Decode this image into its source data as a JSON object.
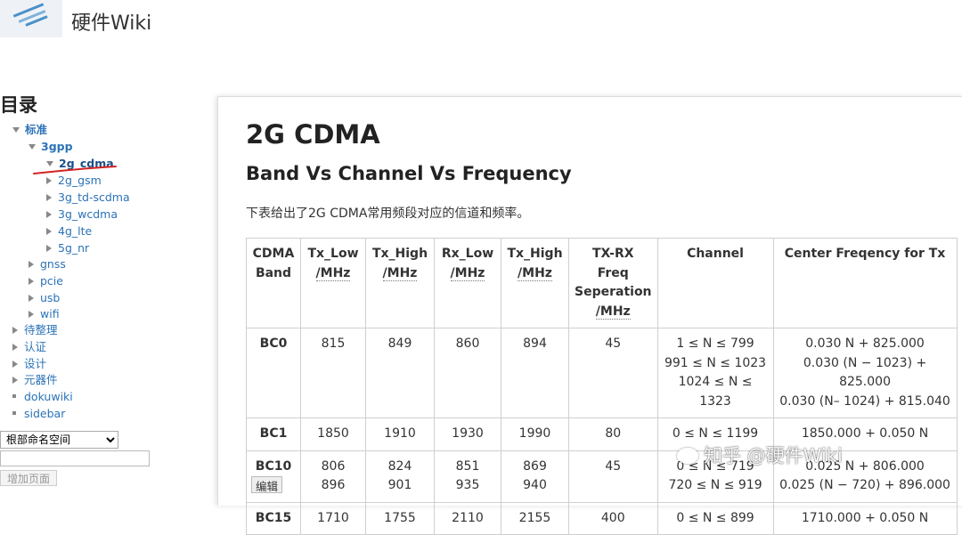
{
  "site": {
    "title": "硬件Wiki"
  },
  "toc": {
    "title": "目录",
    "items": [
      {
        "label": "标准",
        "state": "open"
      },
      {
        "label": "3gpp",
        "state": "open"
      },
      {
        "label": "2g_cdma",
        "state": "open",
        "current": true
      },
      {
        "label": "2g_gsm",
        "state": "closed"
      },
      {
        "label": "3g_td-scdma",
        "state": "closed"
      },
      {
        "label": "3g_wcdma",
        "state": "closed"
      },
      {
        "label": "4g_lte",
        "state": "closed"
      },
      {
        "label": "5g_nr",
        "state": "closed"
      },
      {
        "label": "gnss",
        "state": "closed"
      },
      {
        "label": "pcie",
        "state": "closed"
      },
      {
        "label": "usb",
        "state": "closed"
      },
      {
        "label": "wifi",
        "state": "closed"
      },
      {
        "label": "待整理",
        "state": "closed"
      },
      {
        "label": "认证",
        "state": "closed"
      },
      {
        "label": "设计",
        "state": "closed"
      },
      {
        "label": "元器件",
        "state": "closed"
      },
      {
        "label": "dokuwiki",
        "state": "leaf"
      },
      {
        "label": "sidebar",
        "state": "leaf"
      }
    ],
    "namespace_select": "根部命名空间",
    "add_page_label": "增加页面"
  },
  "page": {
    "h1": "2G CDMA",
    "h2": "Band Vs Channel Vs Frequency",
    "intro": "下表给出了2G CDMA常用频段对应的信道和频率。",
    "table": {
      "headers": [
        [
          "CDMA",
          "Band"
        ],
        [
          "Tx_Low",
          "/MHz"
        ],
        [
          "Tx_High",
          "/MHz"
        ],
        [
          "Rx_Low",
          "/MHz"
        ],
        [
          "Tx_High",
          "/MHz"
        ],
        [
          "TX-RX Freq",
          "Seperation",
          "/MHz"
        ],
        [
          "Channel"
        ],
        [
          "Center Freqency for Tx"
        ]
      ],
      "rows": [
        {
          "band": "BC0",
          "tx_low": [
            "815"
          ],
          "tx_high": [
            "849"
          ],
          "rx_low": [
            "860"
          ],
          "tx_high2": [
            "894"
          ],
          "sep": "45",
          "channel": [
            "1 ≤ N ≤ 799",
            "991 ≤ N ≤ 1023",
            "1024 ≤ N ≤ 1323"
          ],
          "center": [
            "0.030 N + 825.000",
            "0.030 (N − 1023) + 825.000",
            "0.030 (N– 1024) + 815.040"
          ]
        },
        {
          "band": "BC1",
          "tx_low": [
            "1850"
          ],
          "tx_high": [
            "1910"
          ],
          "rx_low": [
            "1930"
          ],
          "tx_high2": [
            "1990"
          ],
          "sep": "80",
          "channel": [
            "0 ≤ N ≤ 1199"
          ],
          "center": [
            "1850.000 + 0.050 N"
          ]
        },
        {
          "band": "BC10",
          "tx_low": [
            "806",
            "896"
          ],
          "tx_high": [
            "824",
            "901"
          ],
          "rx_low": [
            "851",
            "935"
          ],
          "tx_high2": [
            "869",
            "940"
          ],
          "sep": "45",
          "channel": [
            "0 ≤ N ≤ 719",
            "720 ≤ N ≤ 919"
          ],
          "center": [
            "0.025 N + 806.000",
            "0.025 (N − 720) + 896.000"
          ]
        },
        {
          "band": "BC15",
          "tx_low": [
            "1710"
          ],
          "tx_high": [
            "1755"
          ],
          "rx_low": [
            "2110"
          ],
          "tx_high2": [
            "2155"
          ],
          "sep": "400",
          "channel": [
            "0 ≤ N ≤ 899"
          ],
          "center": [
            "1710.000 + 0.050 N"
          ]
        }
      ]
    },
    "edit_label": "编辑"
  },
  "watermark": "知乎 @硬件Wiki",
  "colors": {
    "link": "#2b73b7",
    "annotation_red": "#d42222",
    "panel_bg": "#ffffff"
  }
}
